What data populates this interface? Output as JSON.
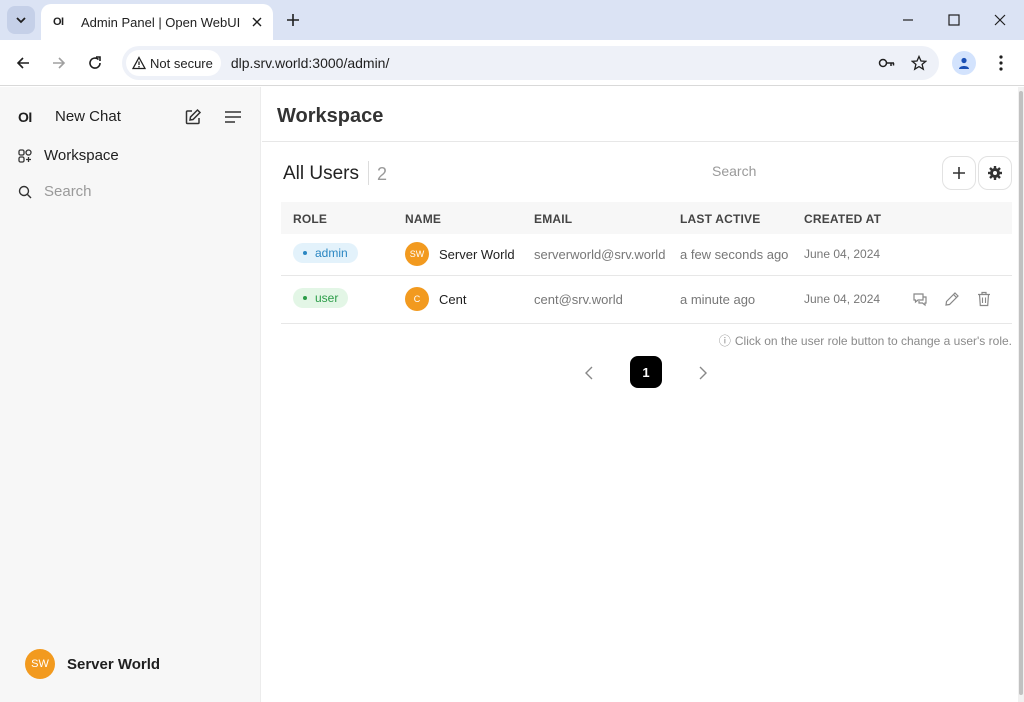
{
  "browser": {
    "tab_favicon": "OI",
    "tab_title": "Admin Panel | Open WebUI",
    "security_label": "Not secure",
    "url": "dlp.srv.world:3000/admin/"
  },
  "sidebar": {
    "logo": "OI",
    "new_chat": "New Chat",
    "workspace": "Workspace",
    "search_placeholder": "Search",
    "user": {
      "initials": "SW",
      "name": "Server World"
    }
  },
  "main": {
    "title": "Workspace",
    "section_title": "All Users",
    "user_count": "2",
    "search_placeholder": "Search",
    "columns": [
      "ROLE",
      "NAME",
      "EMAIL",
      "LAST ACTIVE",
      "CREATED AT"
    ],
    "users": [
      {
        "role": "admin",
        "initials": "SW",
        "name": "Server World",
        "email": "serverworld@srv.world",
        "last_active": "a few seconds ago",
        "created_at": "June 04, 2024"
      },
      {
        "role": "user",
        "initials": "C",
        "name": "Cent",
        "email": "cent@srv.world",
        "last_active": "a minute ago",
        "created_at": "June 04, 2024"
      }
    ],
    "hint": "Click on the user role button to change a user's role.",
    "hint_icon": "ⓘ",
    "current_page": "1"
  },
  "colors": {
    "avatar": "#f29a1f",
    "admin_badge": "#2a86c2",
    "user_badge": "#2b9c48"
  }
}
